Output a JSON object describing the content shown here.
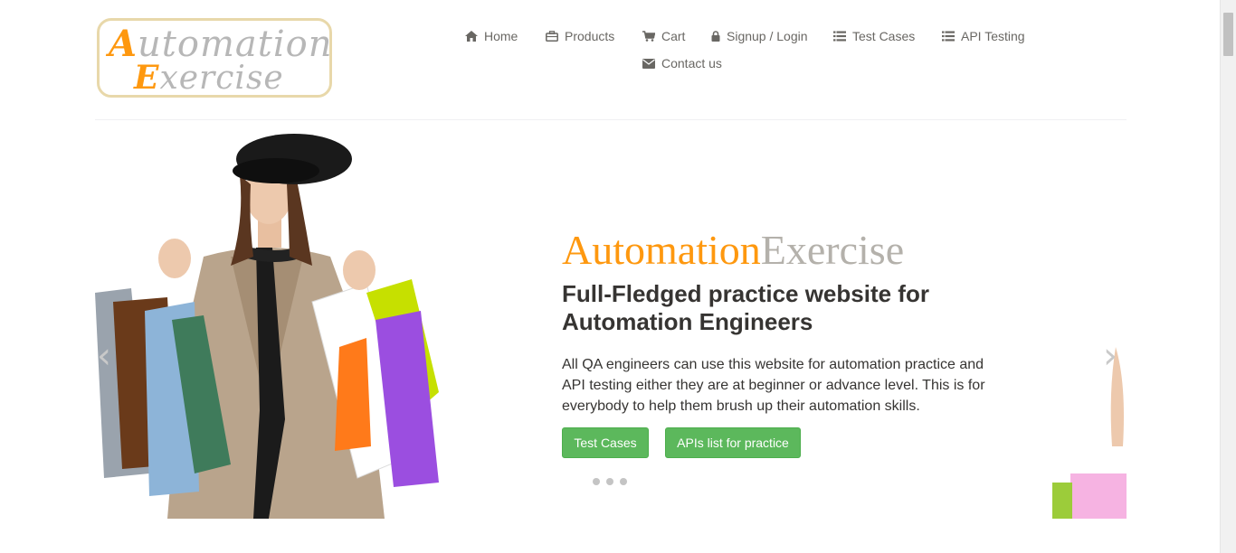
{
  "logo": {
    "line1_first": "A",
    "line1_rest": "utomation",
    "line2_first": "E",
    "line2_rest": "xercise"
  },
  "nav": {
    "items": [
      {
        "label": "Home",
        "icon": "home-icon"
      },
      {
        "label": "Products",
        "icon": "briefcase-icon"
      },
      {
        "label": "Cart",
        "icon": "shopping-cart-icon"
      },
      {
        "label": "Signup / Login",
        "icon": "lock-icon"
      },
      {
        "label": "Test Cases",
        "icon": "list-icon"
      },
      {
        "label": "API Testing",
        "icon": "list-icon"
      },
      {
        "label": "Contact us",
        "icon": "envelope-icon"
      }
    ]
  },
  "hero": {
    "title_part1": "Automation",
    "title_part2": "Exercise",
    "subtitle": "Full-Fledged practice website for Automation Engineers",
    "description": "All QA engineers can use this website for automation practice and API testing either they are at beginner or advance level. This is for everybody to help them brush up their automation skills.",
    "btn_test_cases": "Test Cases",
    "btn_apis": "APIs list for practice",
    "prev_arrow": "‹",
    "next_arrow": "›",
    "slide_count": 3
  },
  "colors": {
    "accent": "#fe980f",
    "button": "#5cb85c",
    "title_gray": "#b4b1ab",
    "nav_text": "#696763"
  }
}
